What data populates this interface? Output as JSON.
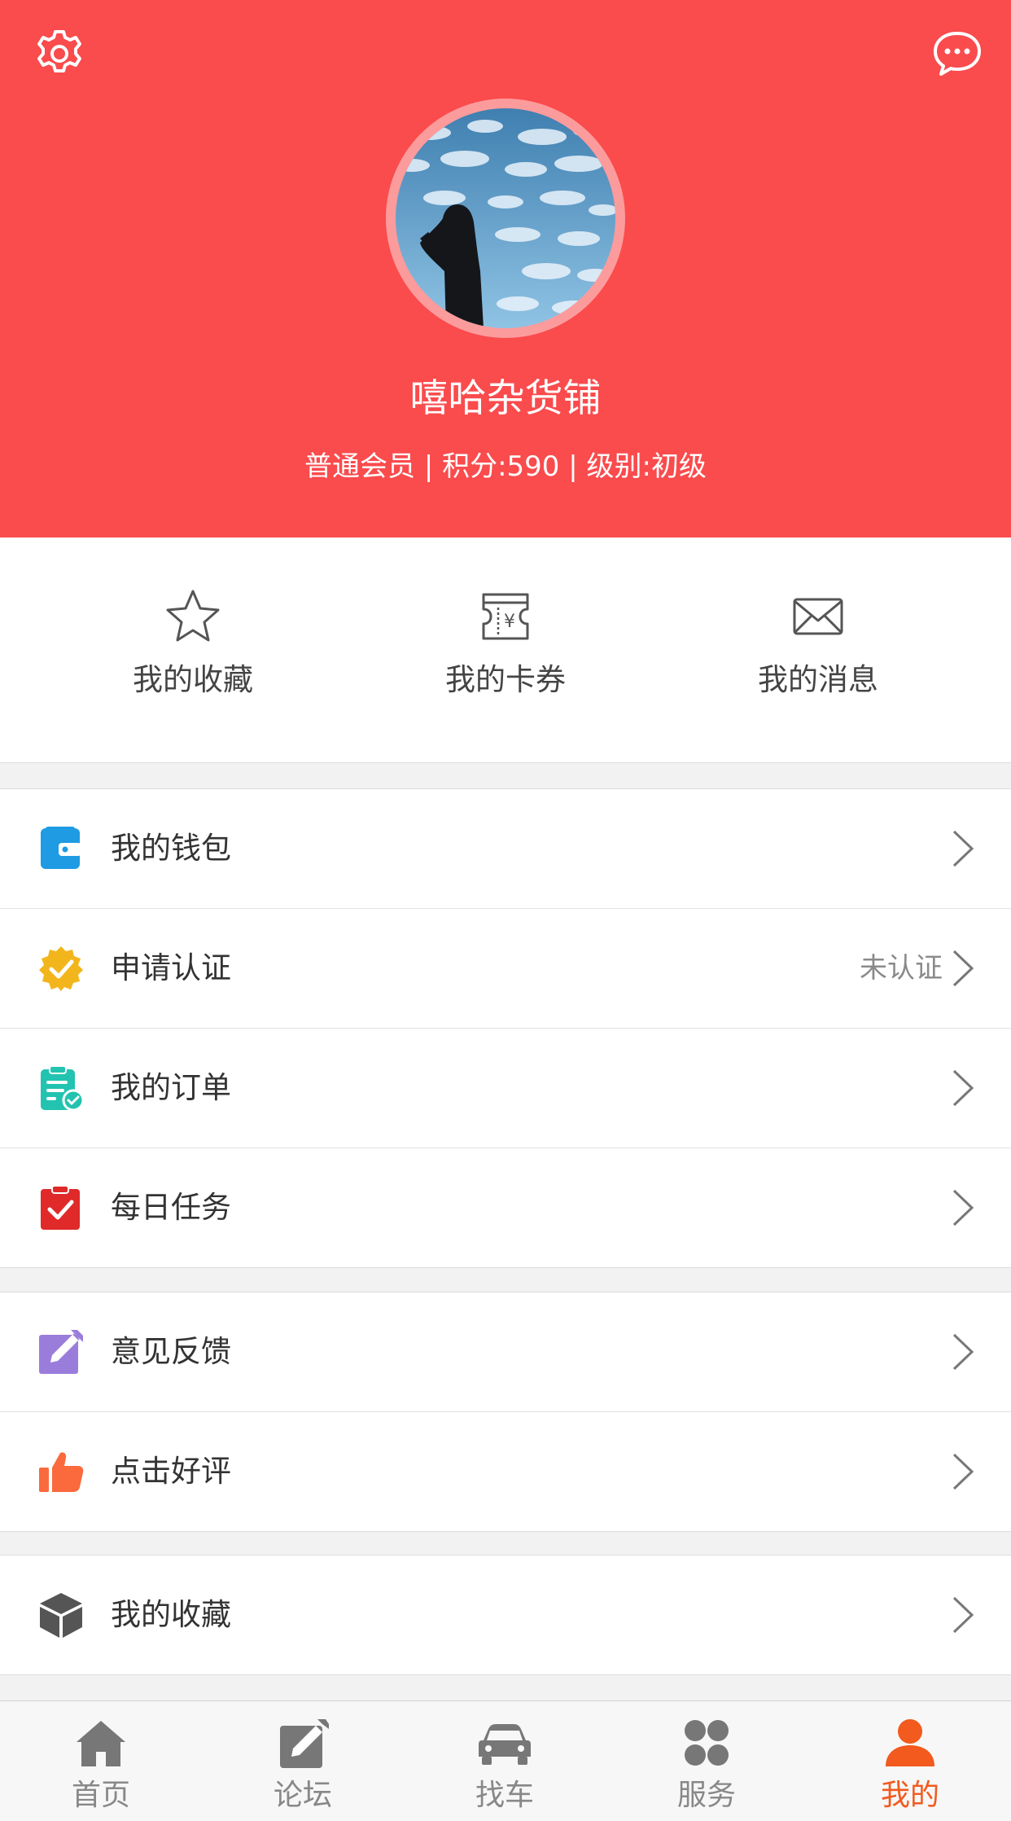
{
  "colors": {
    "header_bg": "#fa4b4d",
    "active_tab": "#f25a1e",
    "wallet": "#1e9be3",
    "verify": "#f2b61c",
    "orders": "#22c3b0",
    "tasks": "#e02a2a",
    "feedback": "#9a7ddb",
    "like": "#fa6a3c",
    "box": "#555555"
  },
  "header": {
    "settings_icon": "gear-icon",
    "message_icon": "chat-bubble-icon",
    "username": "嘻哈杂货铺",
    "meta": "普通会员 | 积分:590 | 级别:初级"
  },
  "quick_actions": [
    {
      "label": "我的收藏",
      "icon": "star-icon"
    },
    {
      "label": "我的卡券",
      "icon": "coupon-icon"
    },
    {
      "label": "我的消息",
      "icon": "envelope-icon"
    }
  ],
  "menu": {
    "group1": [
      {
        "label": "我的钱包",
        "icon": "wallet-icon",
        "value": ""
      },
      {
        "label": "申请认证",
        "icon": "verified-badge-icon",
        "value": "未认证"
      },
      {
        "label": "我的订单",
        "icon": "order-clipboard-icon",
        "value": ""
      },
      {
        "label": "每日任务",
        "icon": "task-clipboard-icon",
        "value": ""
      }
    ],
    "group2": [
      {
        "label": "意见反馈",
        "icon": "feedback-pencil-icon",
        "value": ""
      },
      {
        "label": "点击好评",
        "icon": "thumbs-up-icon",
        "value": ""
      }
    ],
    "group3": [
      {
        "label": "我的收藏",
        "icon": "cube-icon",
        "value": ""
      }
    ]
  },
  "tabbar": [
    {
      "label": "首页",
      "icon": "home-icon",
      "active": false
    },
    {
      "label": "论坛",
      "icon": "edit-icon",
      "active": false
    },
    {
      "label": "找车",
      "icon": "car-icon",
      "active": false
    },
    {
      "label": "服务",
      "icon": "grid-icon",
      "active": false
    },
    {
      "label": "我的",
      "icon": "person-icon",
      "active": true
    }
  ]
}
